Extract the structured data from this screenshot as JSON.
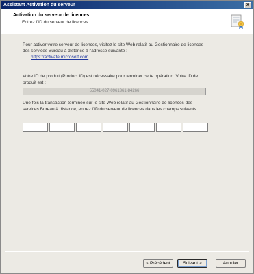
{
  "window": {
    "title": "Assistant Activation du serveur",
    "close_glyph": "x"
  },
  "header": {
    "title": "Activation du serveur de licences",
    "subtitle": "Entrez l'ID du serveur de licences.",
    "icon": "license-server-certificate-icon"
  },
  "intro": {
    "text": "Pour activer votre serveur de licences, visitez le site Web relatif au Gestionnaire de licences des services Bureau à distance à l'adresse suivante :",
    "link": "https://activate.microsoft.com"
  },
  "product": {
    "text": "Votre ID de produit (Product ID) est nécessaire pour terminer cette opération. Votre ID de produit est :",
    "id_value": "55041-027-0961361-84266"
  },
  "instructions": {
    "text": "Une fois la transaction terminée sur le site Web relatif au Gestionnaire de licences des services Bureau à distance, entrez l'ID du serveur de licences dans les champs suivants."
  },
  "id_fields": [
    "",
    "",
    "",
    "",
    "",
    "",
    ""
  ],
  "buttons": {
    "back": "< Précédent",
    "next": "Suivant >",
    "cancel": "Annuler"
  }
}
